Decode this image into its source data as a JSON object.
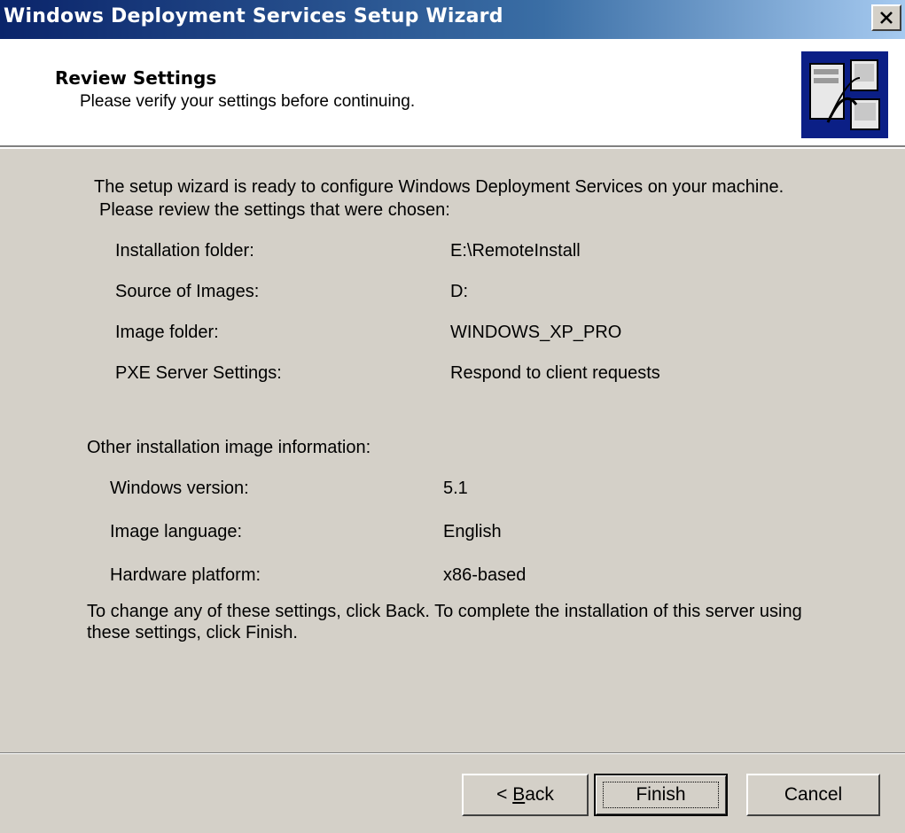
{
  "window": {
    "title": "Windows Deployment Services Setup Wizard"
  },
  "header": {
    "title": "Review Settings",
    "subtitle": "Please verify your settings before continuing."
  },
  "intro": {
    "line1": "The setup wizard is ready to configure Windows Deployment Services on your machine.",
    "line2": "Please review the settings that were chosen:"
  },
  "settings": [
    {
      "label": "Installation folder:",
      "value": "E:\\RemoteInstall"
    },
    {
      "label": "Source of Images:",
      "value": "D:"
    },
    {
      "label": "Image folder:",
      "value": "WINDOWS_XP_PRO"
    },
    {
      "label": "PXE Server Settings:",
      "value": "Respond to client requests"
    }
  ],
  "other": {
    "heading": "Other installation image information:",
    "items": [
      {
        "label": "Windows version:",
        "value": "5.1"
      },
      {
        "label": "Image language:",
        "value": "English"
      },
      {
        "label": "Hardware platform:",
        "value": "x86-based"
      }
    ]
  },
  "footer_note": "To change any of these settings, click Back. To complete the installation of this server using these settings, click Finish.",
  "buttons": {
    "back_prefix": "< ",
    "back_mnemonic": "B",
    "back_rest": "ack",
    "finish": "Finish",
    "cancel": "Cancel"
  },
  "icons": {
    "close": "close-icon",
    "wizard": "wizard-header-icon"
  },
  "colors": {
    "titlebar_start": "#0a246a",
    "titlebar_end": "#a6caf0",
    "dialog_bg": "#d4d0c8",
    "header_bg": "#ffffff"
  }
}
